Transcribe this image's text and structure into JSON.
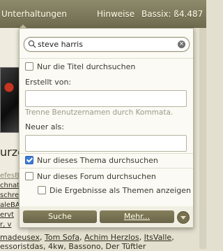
{
  "nav": {
    "items": [
      "Unterhaltungen",
      "Hinweise",
      "Bassix: ß4.487"
    ]
  },
  "background": {
    "title_fragment": "urze",
    "lines": [
      "efesB",
      "chnat",
      "schre",
      "aleBA",
      "ervt",
      "r, v"
    ],
    "userlist_1": [
      "madeusex",
      "Tom Sofa",
      "Achim Herzlos",
      "ItsValle"
    ],
    "userlist_2": "essoristdas, 4kw, Bassono, Der Tüftler"
  },
  "search": {
    "query": "steve harris",
    "placeholder": "",
    "titles_only_label": "Nur die Titel durchsuchen",
    "titles_only_checked": false,
    "created_by_label": "Erstellt von:",
    "created_by_value": "",
    "created_by_hint": "Trenne Benutzernamen durch Kommata.",
    "newer_than_label": "Neuer als:",
    "newer_than_value": "",
    "this_thread_label": "Nur dieses Thema durchsuchen",
    "this_thread_checked": true,
    "this_forum_label": "Nur dieses Forum durchsuchen",
    "this_forum_checked": false,
    "as_threads_label": "Die Ergebnisse als Themen anzeigen",
    "as_threads_checked": false,
    "search_button": "Suche",
    "more_button": "Mehr..."
  },
  "colors": {
    "bar": "#7b7658",
    "checkbox_accent": "#3d7bd8"
  }
}
